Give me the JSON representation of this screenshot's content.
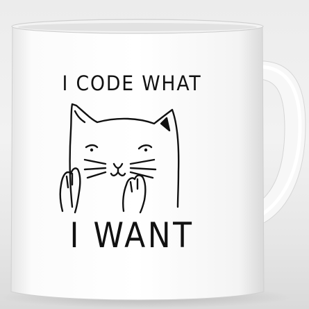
{
  "product_photo": {
    "subject": "white ceramic coffee mug",
    "background_color": "#ececec",
    "mug_color": "#ffffff",
    "print_color": "#111111",
    "illustration_icon": "cat-icon"
  },
  "print": {
    "line_1": "I CODE WHAT",
    "line_2": "I WANT"
  }
}
